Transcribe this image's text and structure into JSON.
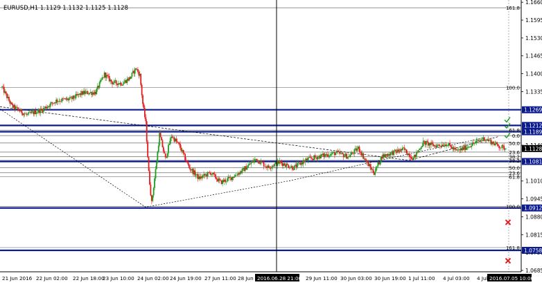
{
  "window": {
    "title": "EURUSD,H1  1.1129 1.1132 1.1125 1.1128"
  },
  "colors": {
    "background": "#ffffff",
    "candle_up": "#1f9e1f",
    "candle_down": "#e31b1b",
    "level_line": "#0b1a8c",
    "fib_line": "#505050",
    "trend_line": "#000000",
    "price_badge_bg": "#0b1a8c",
    "price_badge_text": "#ffffff",
    "cursor_line": "#000000",
    "check_mark": "#1f9e1f",
    "cross_mark": "#e31b1b"
  },
  "price_axis": {
    "ticks": [
      {
        "value": 1.166,
        "label": "1.1660"
      },
      {
        "value": 1.1595,
        "label": "1.1595"
      },
      {
        "value": 1.153,
        "label": "1.1530"
      },
      {
        "value": 1.1465,
        "label": "1.1465"
      },
      {
        "value": 1.14,
        "label": "1.1400"
      },
      {
        "value": 1.1335,
        "label": "1.1335"
      },
      {
        "value": 1.114,
        "label": "1.1140"
      },
      {
        "value": 1.101,
        "label": "1.1010"
      },
      {
        "value": 1.0945,
        "label": "1.0945"
      },
      {
        "value": 1.088,
        "label": "1.0880"
      },
      {
        "value": 1.0815,
        "label": "1.0815"
      },
      {
        "value": 1.075,
        "label": "1.0750"
      },
      {
        "value": 1.0685,
        "label": "1.0685"
      }
    ]
  },
  "time_axis": {
    "labels": [
      "21 Jun 2016",
      "22 Jun 02:00",
      "22 Jun 18:00",
      "23 Jun 10:00",
      "24 Jun 02:00",
      "24 Jun 19:00",
      "27 Jun 11:00",
      "28 Jun 03:00",
      "29 Jun 11:00",
      "30 Jun 03:00",
      "30 Jun 19:00",
      "1 Jul 11:00",
      "4 Jul 03:00",
      "4 Jul 19:00"
    ],
    "crosshair_time": "2016.06.28 21:00",
    "last_time": "2016.07.05 10:00"
  },
  "level_badges": [
    {
      "value": 1.1269,
      "label": "1.1269"
    },
    {
      "value": 1.1212,
      "label": "1.1212"
    },
    {
      "value": 1.1189,
      "label": "1.1189"
    },
    {
      "value": 1.1128,
      "label": "1.1128"
    },
    {
      "value": 1.1081,
      "label": "1.1081"
    },
    {
      "value": 1.0912,
      "label": "1.0912"
    },
    {
      "value": 1.0758,
      "label": "1.0758"
    }
  ],
  "fib_labels": [
    {
      "value": 1.164,
      "label": "161.8"
    },
    {
      "value": 1.135,
      "label": "100.0"
    },
    {
      "value": 1.1195,
      "label": "61.8"
    },
    {
      "value": 1.1175,
      "label": "0.0"
    },
    {
      "value": 1.1148,
      "label": "50.0"
    },
    {
      "value": 1.1115,
      "label": "23.6"
    },
    {
      "value": 1.1098,
      "label": "38.2"
    },
    {
      "value": 1.1085,
      "label": "38.2"
    },
    {
      "value": 1.1058,
      "label": "50.0"
    },
    {
      "value": 1.104,
      "label": "23.6"
    },
    {
      "value": 1.1026,
      "label": "61.8"
    },
    {
      "value": 1.0918,
      "label": "100.0"
    },
    {
      "value": 1.0768,
      "label": "161.8"
    }
  ],
  "chart_data": {
    "type": "candlestick",
    "symbol": "EURUSD",
    "timeframe": "H1",
    "ohlc_last": {
      "open": 1.1129,
      "high": 1.1132,
      "low": 1.1125,
      "close": 1.1128
    },
    "ylim": [
      1.068,
      1.1668
    ],
    "grid": false,
    "trend_path": [
      {
        "x": 0.0,
        "price": 1.1272
      },
      {
        "x": 210.0,
        "price": 1.0915
      },
      {
        "x": 420.0,
        "price": 1.1012
      },
      {
        "x": 560.0,
        "price": 1.1092
      },
      {
        "x": 700.0,
        "price": 1.1168
      }
    ],
    "upper_dashed_path": [
      {
        "x": 0.0,
        "price": 1.128
      },
      {
        "x": 590.0,
        "price": 1.1085
      },
      {
        "x": 720.0,
        "price": 1.1172
      }
    ],
    "checks": [
      1.1232,
      1.121,
      1.1175
    ],
    "crosses": [
      1.086,
      1.072
    ],
    "anchors": [
      {
        "i": 0,
        "p": 1.135
      },
      {
        "i": 10,
        "p": 1.1282
      },
      {
        "i": 25,
        "p": 1.125
      },
      {
        "i": 40,
        "p": 1.1268
      },
      {
        "i": 55,
        "p": 1.1302
      },
      {
        "i": 70,
        "p": 1.1308
      },
      {
        "i": 82,
        "p": 1.133
      },
      {
        "i": 95,
        "p": 1.1332
      },
      {
        "i": 104,
        "p": 1.1398
      },
      {
        "i": 112,
        "p": 1.1368
      },
      {
        "i": 122,
        "p": 1.1365
      },
      {
        "i": 130,
        "p": 1.1385
      },
      {
        "i": 136,
        "p": 1.142
      },
      {
        "i": 140,
        "p": 1.1395
      },
      {
        "i": 143,
        "p": 1.129
      },
      {
        "i": 146,
        "p": 1.122
      },
      {
        "i": 149,
        "p": 1.104
      },
      {
        "i": 152,
        "p": 1.093
      },
      {
        "i": 156,
        "p": 1.105
      },
      {
        "i": 160,
        "p": 1.118
      },
      {
        "i": 166,
        "p": 1.109
      },
      {
        "i": 172,
        "p": 1.1175
      },
      {
        "i": 180,
        "p": 1.114
      },
      {
        "i": 190,
        "p": 1.106
      },
      {
        "i": 200,
        "p": 1.102
      },
      {
        "i": 212,
        "p": 1.104
      },
      {
        "i": 222,
        "p": 1.1005
      },
      {
        "i": 232,
        "p": 1.102
      },
      {
        "i": 245,
        "p": 1.105
      },
      {
        "i": 258,
        "p": 1.109
      },
      {
        "i": 270,
        "p": 1.106
      },
      {
        "i": 282,
        "p": 1.1078
      },
      {
        "i": 296,
        "p": 1.1058
      },
      {
        "i": 310,
        "p": 1.1088
      },
      {
        "i": 325,
        "p": 1.1102
      },
      {
        "i": 340,
        "p": 1.1112
      },
      {
        "i": 352,
        "p": 1.1098
      },
      {
        "i": 362,
        "p": 1.113
      },
      {
        "i": 370,
        "p": 1.108
      },
      {
        "i": 378,
        "p": 1.104
      },
      {
        "i": 386,
        "p": 1.11
      },
      {
        "i": 396,
        "p": 1.1112
      },
      {
        "i": 408,
        "p": 1.1125
      },
      {
        "i": 418,
        "p": 1.1092
      },
      {
        "i": 428,
        "p": 1.115
      },
      {
        "i": 440,
        "p": 1.1138
      },
      {
        "i": 452,
        "p": 1.1145
      },
      {
        "i": 462,
        "p": 1.1118
      },
      {
        "i": 470,
        "p": 1.113
      },
      {
        "i": 480,
        "p": 1.1148
      },
      {
        "i": 490,
        "p": 1.1165
      },
      {
        "i": 498,
        "p": 1.115
      },
      {
        "i": 506,
        "p": 1.1135
      },
      {
        "i": 512,
        "p": 1.1128
      }
    ],
    "n_candles": 513
  }
}
